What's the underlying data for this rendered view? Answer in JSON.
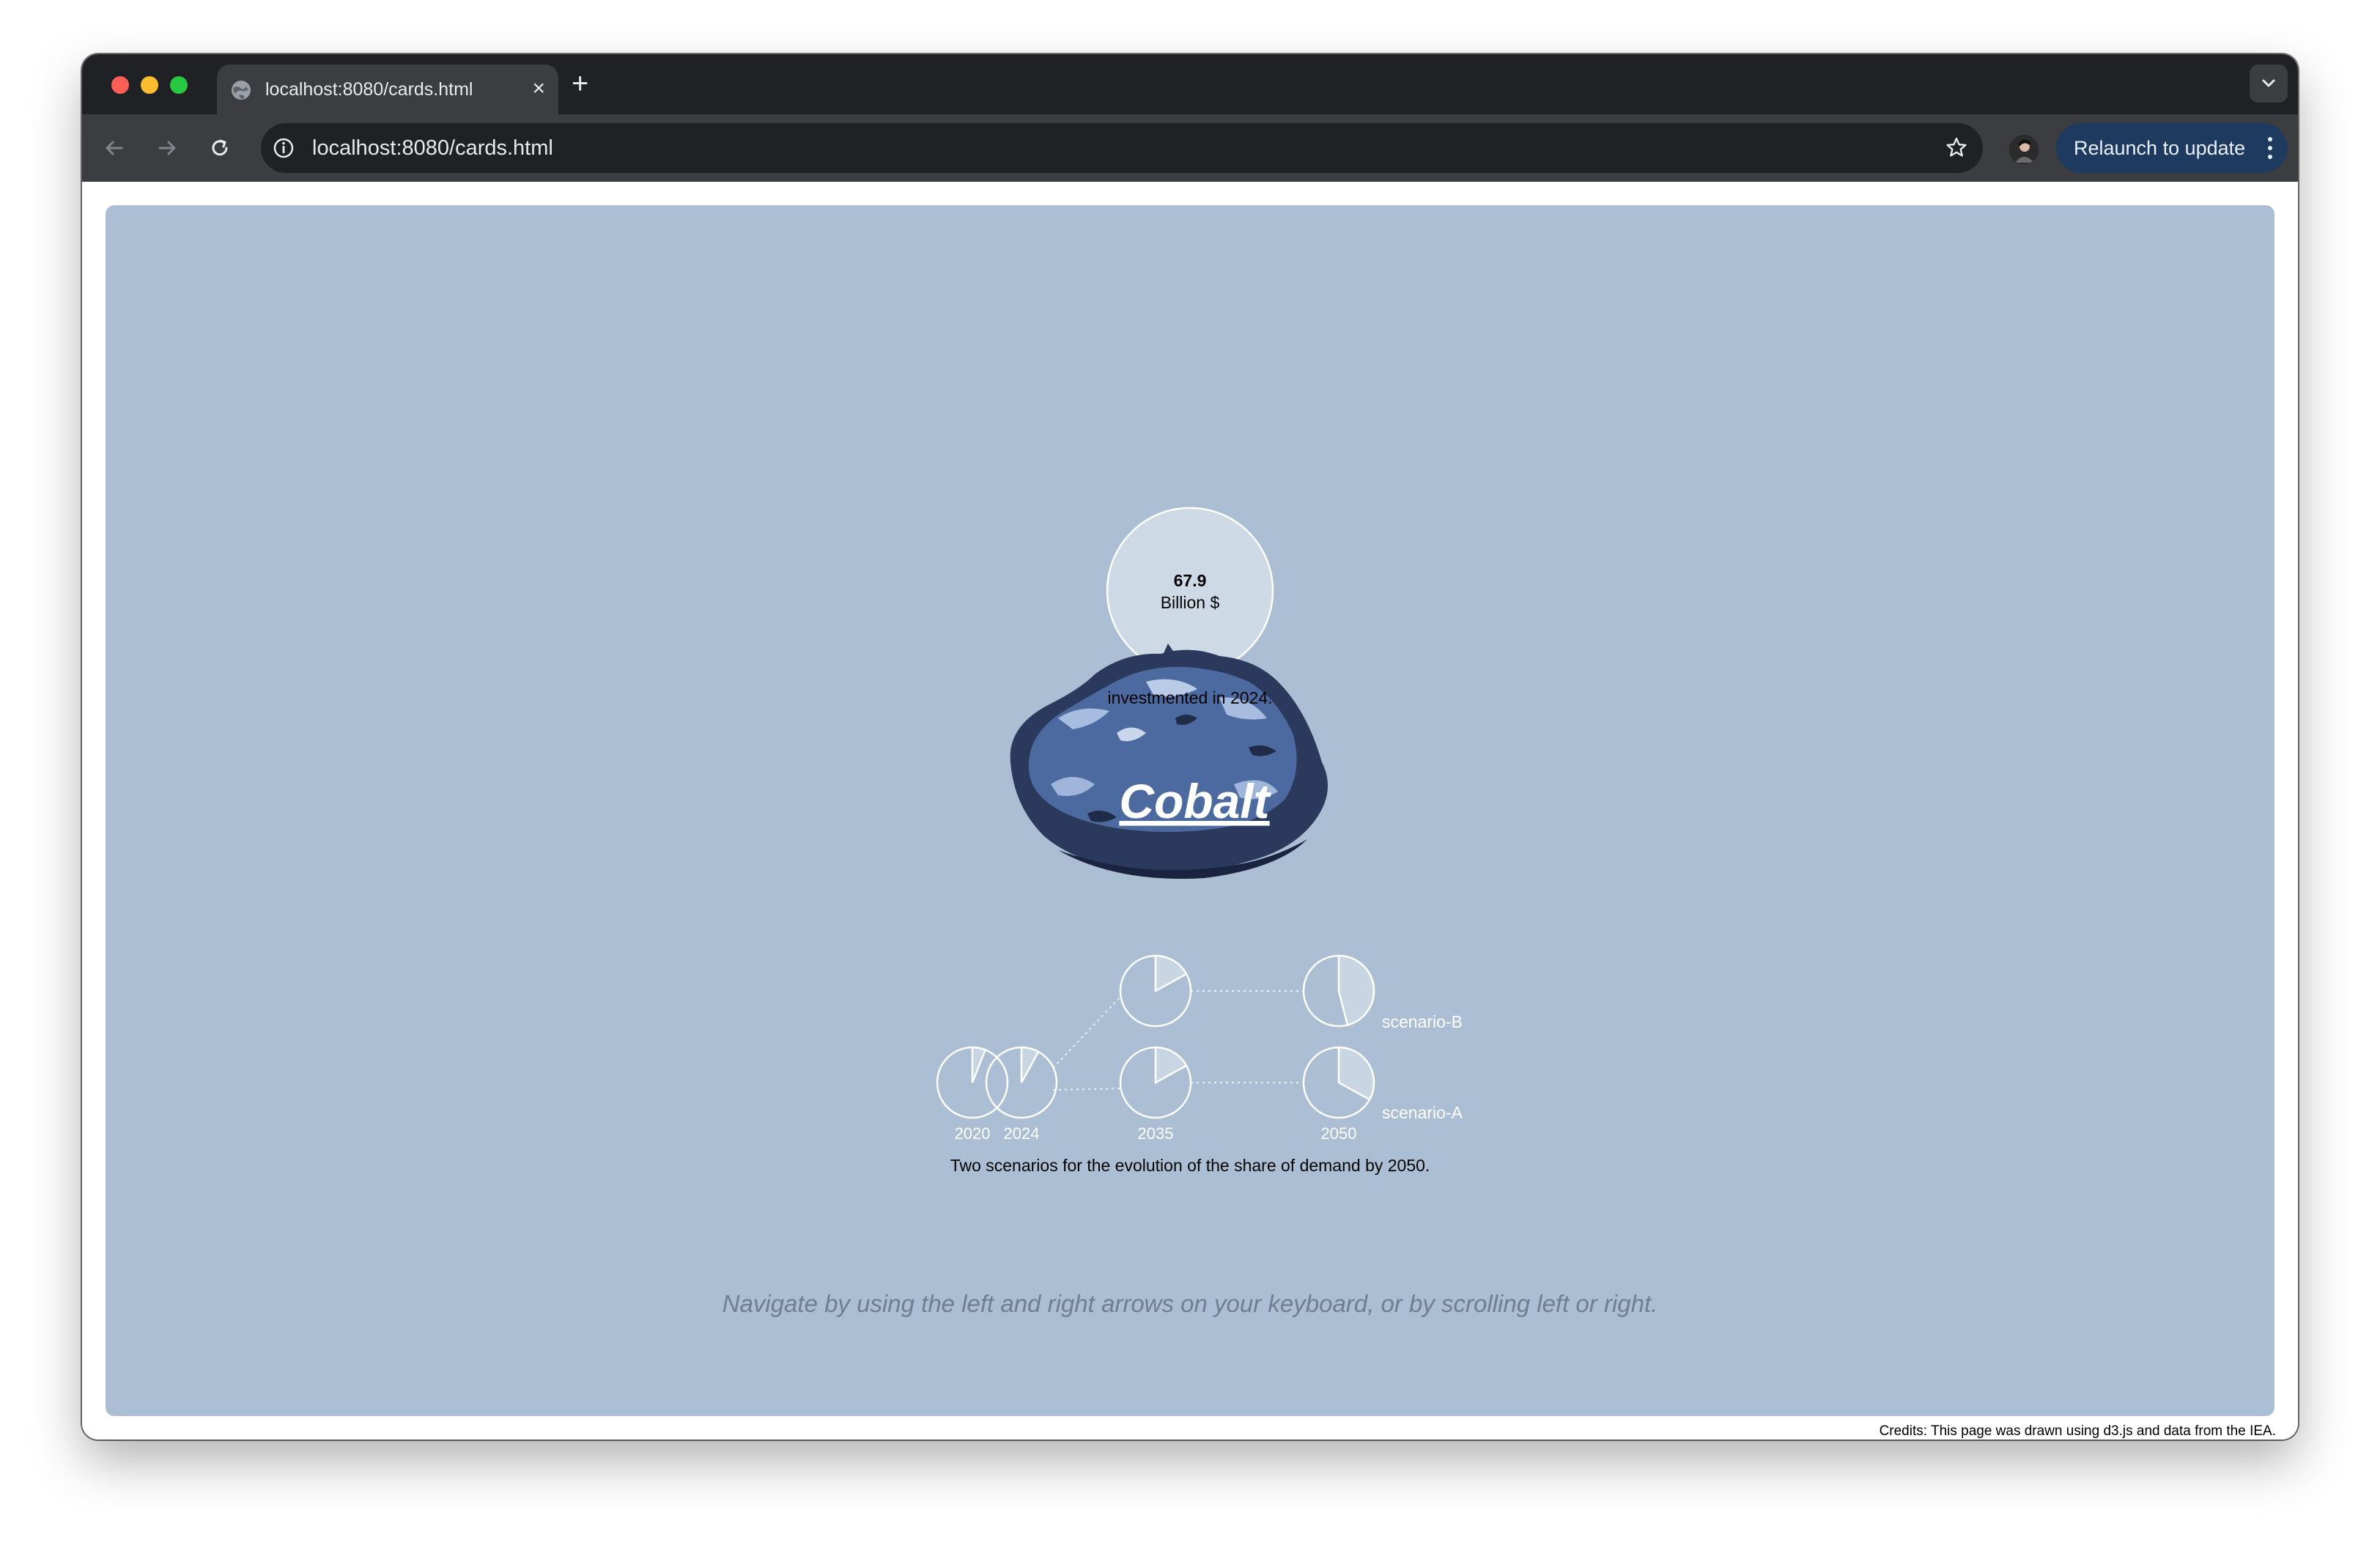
{
  "browser": {
    "tab_title": "localhost:8080/cards.html",
    "url": "localhost:8080/cards.html",
    "relaunch_label": "Relaunch to update"
  },
  "card": {
    "mineral": "Cobalt",
    "investment": {
      "value": "67.9",
      "unit": "Billion $",
      "caption": "investmented in 2024."
    },
    "demand": {
      "years": [
        "2020",
        "2024",
        "2035",
        "2050"
      ],
      "scenarios": [
        "scenario-B",
        "scenario-A"
      ],
      "caption": "Two scenarios for the evolution of the share of demand by 2050."
    },
    "nav_hint": "Navigate by using the left and right arrows on your keyboard, or by scrolling left or right.",
    "credits": "Credits: This page was drawn using d3.js and data from the IEA."
  },
  "chart_data": {
    "type": "pie",
    "title": "",
    "series": [
      {
        "label": "2020",
        "share": 0.06
      },
      {
        "label": "2024",
        "share": 0.08
      },
      {
        "label": "2035 scenario-B",
        "share": 0.17
      },
      {
        "label": "2050 scenario-B",
        "share": 0.46
      },
      {
        "label": "2035 scenario-A",
        "share": 0.17
      },
      {
        "label": "2050 scenario-A",
        "share": 0.33
      }
    ]
  },
  "colors": {
    "card_background": "#abbed3",
    "bubble_fill": "#cdd9e4",
    "pie_stroke": "#ffffff",
    "browser_dark": "#202124",
    "browser_toolbar": "#3c3d41",
    "relaunch_button": "#1f3a5f"
  }
}
